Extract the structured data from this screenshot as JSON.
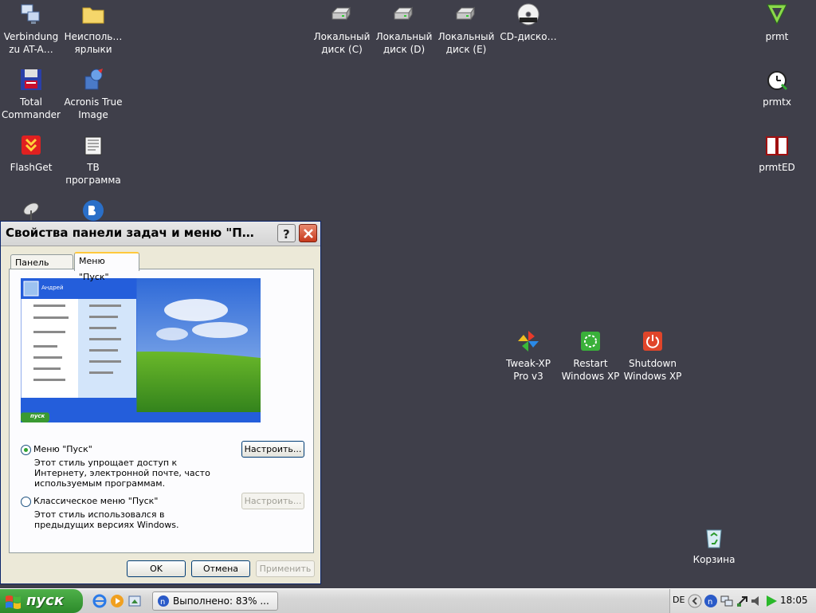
{
  "desktop": {
    "icons": [
      {
        "label": "Verbindung\nzu AT-A…",
        "icon": "network-connection-icon"
      },
      {
        "label": "Неисполь…\nярлыки",
        "icon": "folder-icon"
      },
      {
        "label": "Total\nCommander",
        "icon": "floppy-icon"
      },
      {
        "label": "Acronis True\nImage",
        "icon": "acronis-icon"
      },
      {
        "label": "FlashGet",
        "icon": "flashget-icon"
      },
      {
        "label": "ТВ\nпрограмма",
        "icon": "tv-program-icon"
      },
      {
        "label": "Локальный\nдиск (C)",
        "icon": "hard-disk-icon"
      },
      {
        "label": "Локальный\nдиск (D)",
        "icon": "hard-disk-icon"
      },
      {
        "label": "Локальный\nдиск (E)",
        "icon": "hard-disk-icon"
      },
      {
        "label": "CD-диско…",
        "icon": "dvd-drive-icon"
      },
      {
        "label": "prmt",
        "icon": "prmt-icon"
      },
      {
        "label": "prmtx",
        "icon": "alarm-clock-icon"
      },
      {
        "label": "prmtED",
        "icon": "book-icon"
      },
      {
        "label": "Tweak-XP\nPro v3",
        "icon": "pinwheel-icon"
      },
      {
        "label": "Restart\nWindows XP",
        "icon": "restart-icon"
      },
      {
        "label": "Shutdown\nWindows XP",
        "icon": "power-icon"
      },
      {
        "label": "Корзина",
        "icon": "recycle-bin-icon"
      }
    ]
  },
  "dialog": {
    "title": "Свойства панели задач и меню \"П…",
    "tabs": [
      "Панель задач",
      "Меню \"Пуск\""
    ],
    "preview": {
      "user": "Андрей",
      "start_label": "пуск"
    },
    "option_start": {
      "label": "Меню \"Пуск\"",
      "description": "Этот стиль упрощает доступ к Интернету, электронной почте, часто используемым программам.",
      "button": "Настроить...",
      "selected": true
    },
    "option_classic": {
      "label": "Классическое меню \"Пуск\"",
      "description": "Этот стиль использовался в предыдущих версиях Windows.",
      "button": "Настроить...",
      "selected": false
    },
    "buttons": {
      "ok": "OK",
      "cancel": "Отмена",
      "apply": "Применить"
    }
  },
  "taskbar": {
    "start_label": "пуск",
    "task_item": "Выполнено: 83% ...",
    "language": "DE",
    "clock": "18:05"
  }
}
